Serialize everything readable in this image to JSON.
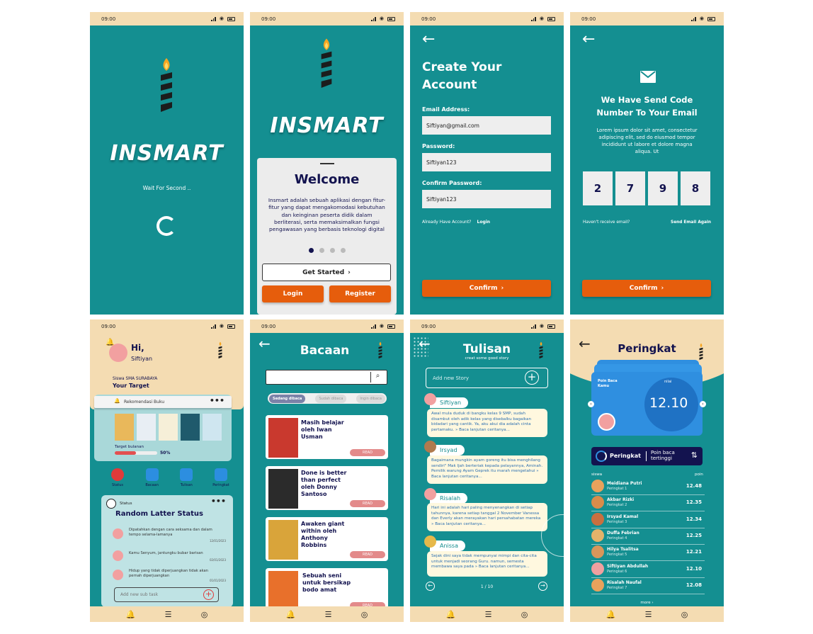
{
  "status_time": "09:00",
  "app_name": "INSMART",
  "splash": {
    "wait_text": "Wait For Second .."
  },
  "welcome": {
    "title": "Welcome",
    "body": "Insmart adalah sebuah aplikasi dengan fitur-fitur yang dapat mengakomodasi kebutuhan dan keinginan peserta didik dalam berliterasi, serta memaksimalkan fungsi pengawasan yang berbasis teknologi digital",
    "get_started": "Get Started",
    "login": "Login",
    "register": "Register"
  },
  "create_account": {
    "title_line1": "Create Your",
    "title_line2": "Account",
    "email_label": "Email Address:",
    "email_value": "Siftiyan@gmail.com",
    "password_label": "Password:",
    "password_value": "Siftiyan123",
    "confirm_label": "Confirm Password:",
    "confirm_value": "Siftiyan123",
    "already": "Already Have Account?",
    "login_link": "Login",
    "confirm_btn": "Confirm"
  },
  "verify": {
    "title_line1": "We Have Send Code",
    "title_line2": "Number To Your Email",
    "body": "Lorem ipsum dolor sit amet, consectetur adipiscing elit, sed do eiusmod tempor incididunt ut labore et dolore magna aliqua. Ut",
    "digits": [
      "2",
      "7",
      "9",
      "8"
    ],
    "not_received": "Haven't receive email?",
    "send_again": "Send  Email Again",
    "confirm_btn": "Confirm"
  },
  "home": {
    "greeting": "Hi,",
    "name": "Siftiyan",
    "school": "Siswa SMA SURABAYA",
    "target_title": "Your Target",
    "rekomendasi": "Rekomendasi Buku",
    "target_bulanan": "Target bulanan",
    "target_pct": "50%",
    "target_fraction": 0.5,
    "menu": [
      "Status",
      "Bacaan",
      "Tulisan",
      "Peringkat"
    ],
    "status_label": "Status",
    "status_title": "Random Latter Status",
    "statuses": [
      {
        "text": "Dipatahkan dengan cara seksama dan dalam tempo selama-lamanya",
        "date": "12/01/2023"
      },
      {
        "text": "Kamu Senyum, jantungku bubar barisan",
        "date": "02/01/2023"
      },
      {
        "text": "Hidup yang tidak diperjuangkan tidak akan pernah diperjuangkan",
        "date": "01/01/2023"
      }
    ],
    "add_task_placeholder": "Add new sub task"
  },
  "bacaan": {
    "title": "Bacaan",
    "tabs": [
      "Sedang dibaca",
      "Sudah dibaca",
      "Ingin dibaca"
    ],
    "books": [
      {
        "title": "Masih belajar oleh Iwan Usman",
        "read": "READ"
      },
      {
        "title": "Done is better than perfect oleh Donny Santoso",
        "read": "READ"
      },
      {
        "title": "Awaken giant within oleh Anthony Robbins",
        "read": "READ"
      },
      {
        "title": "Sebuah seni untuk bersikap bodo amat",
        "read": "READ"
      }
    ]
  },
  "tulisan": {
    "title": "Tulisan",
    "subtitle": "creat some good story",
    "add_placeholder": "Add new Story",
    "stories": [
      {
        "name": "Siftiyan",
        "text": "Awal mula duduk di bangku kelas 9 SMP, sudah disambut oleh adik kelas yang disebalku bagaikan bidadari yang cantik. Ya, aku akui dia adalah cinta pertamaku. » Baca lanjutan ceritanya..."
      },
      {
        "name": "Irsyad",
        "text": "Bagaimana mungkin ayam goreng itu bisa menghilang sendiri\" Mak Ijah berteriak kepada pelayannya, Aminah. Pemilik warung Ayam Geprek itu marah mengetahui » Baca lanjutan ceritanya..."
      },
      {
        "name": "Risalah",
        "text": "Hari ini adalah hari paling menyenangkan di setiap tahunnya, karena setiap tanggal 2 November Vanessa dan Everly akan merayakan hari persahabatan mereka » Baca lanjutan ceritanya..."
      },
      {
        "name": "Anissa",
        "text": "Sejak dini saya tidak mempunyai mimpi dan cita-cita untuk menjadi seorang Guru. namun, semesta membawa saya pada » Baca lanjutan ceritanya..."
      }
    ],
    "page": "1  /  10"
  },
  "peringkat": {
    "title": "Peringkat",
    "card_label_line1": "Poin Baca",
    "card_label_line2": "Kamu",
    "nilai_label": "nilai",
    "nilai": "12.10",
    "toggle_left": "Peringkat",
    "toggle_right": "Poin baca tertinggi",
    "col_siswa": "siswa",
    "col_poin": "poin",
    "ranks": [
      {
        "name": "Meidiana Putri",
        "rank": "Peringkat 1",
        "poin": "12.48"
      },
      {
        "name": "Akbar Rizki",
        "rank": "Peringkat 2",
        "poin": "12.35"
      },
      {
        "name": "Irsyad Kamal",
        "rank": "Peringkat 3",
        "poin": "12.34"
      },
      {
        "name": "Duffa Febrian",
        "rank": "Peringkat 4",
        "poin": "12.25"
      },
      {
        "name": "Hilya Tsalitsa",
        "rank": "Peringkat 5",
        "poin": "12.21"
      },
      {
        "name": "Siftiyan Abdullah",
        "rank": "Peringkat 6",
        "poin": "12.10"
      },
      {
        "name": "Risalah Naufal",
        "rank": "Peringkat 7",
        "poin": "12.08"
      }
    ],
    "more": "more"
  },
  "colors": {
    "teal": "#148f91",
    "cream": "#f4dcb2",
    "orange": "#e65d0c",
    "navy": "#13134f",
    "blue": "#2f8fe0"
  }
}
